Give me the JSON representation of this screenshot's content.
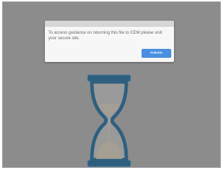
{
  "dialog": {
    "message": "To access guidance on returning this file to CEM please visit your secure site.",
    "finish_label": "FINISH"
  },
  "loading_indicator": {
    "icon": "hourglass-icon"
  },
  "colors": {
    "overlay": "#8c8c8c",
    "dialog_background": "#f7f7f7",
    "dialog_header": "#d6d6d6",
    "button": "#4a8fe0",
    "hourglass_frame": "#2f5f7f"
  }
}
